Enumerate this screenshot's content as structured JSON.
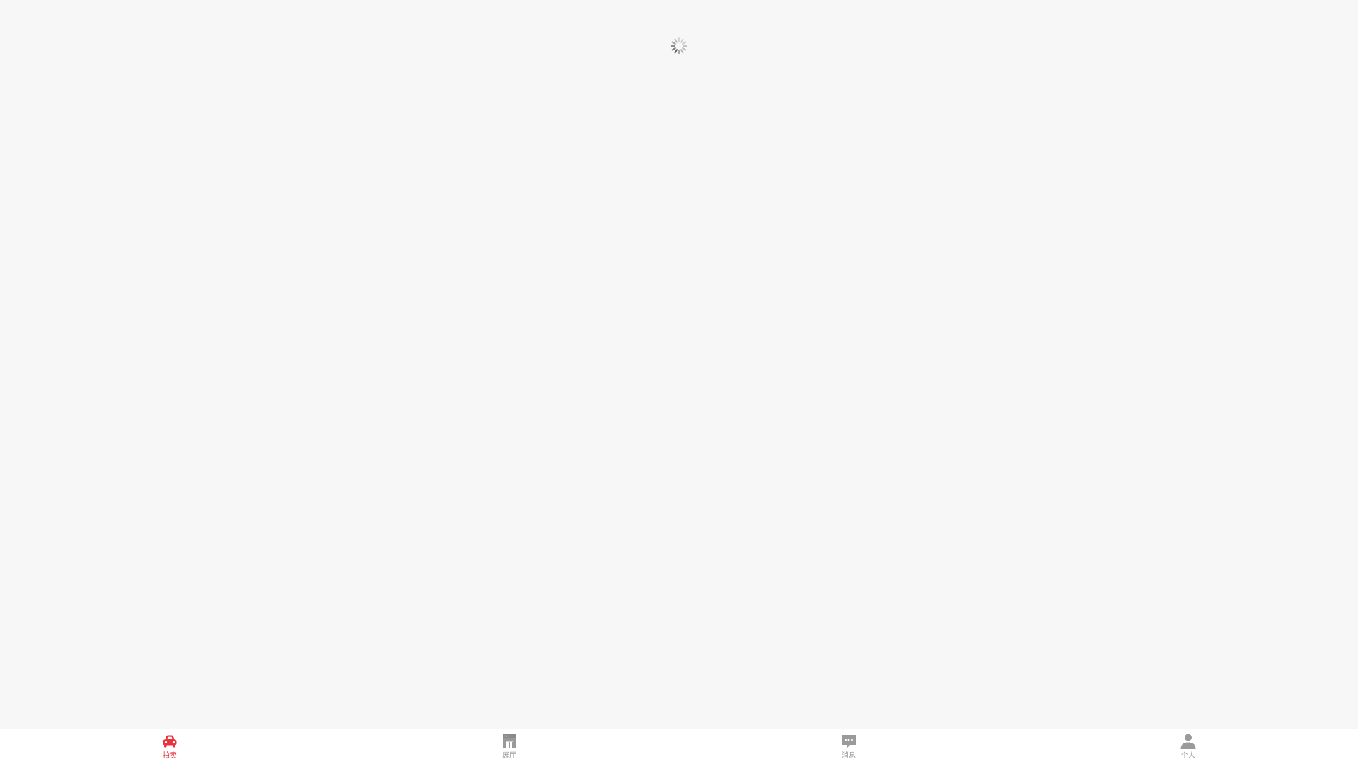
{
  "colors": {
    "accent": "#e8323c",
    "inactive": "#9a9a9a",
    "background": "#f7f7f7",
    "tabbar": "#ffffff"
  },
  "loading": {
    "icon": "spinner-icon"
  },
  "tabbar": {
    "items": [
      {
        "label": "拍卖",
        "icon": "car-icon",
        "active": true
      },
      {
        "label": "展厅",
        "icon": "storefront-icon",
        "active": false
      },
      {
        "label": "消息",
        "icon": "chat-bubble-icon",
        "active": false
      },
      {
        "label": "个人",
        "icon": "user-icon",
        "active": false
      }
    ]
  }
}
